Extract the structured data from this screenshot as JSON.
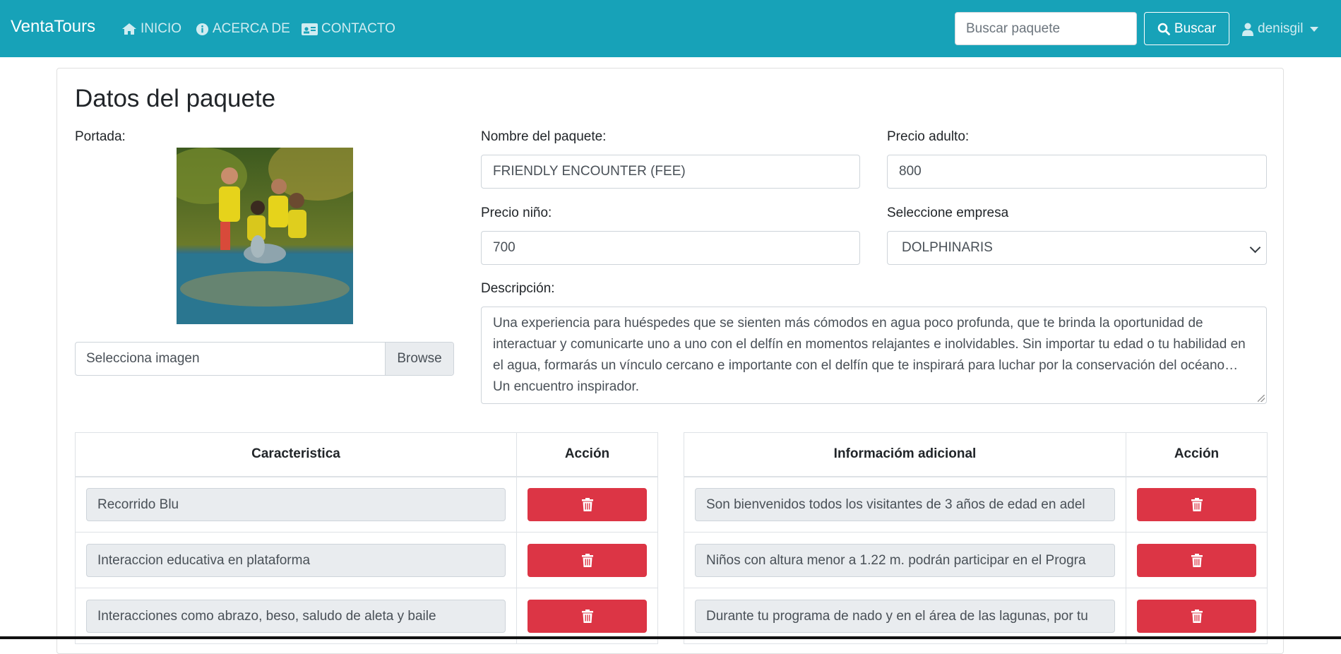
{
  "navbar": {
    "brand": "VentaTours",
    "links": [
      {
        "label": "INICIO",
        "icon": "home-icon"
      },
      {
        "label": "ACERCA DE",
        "icon": "info-circle-icon"
      },
      {
        "label": "CONTACTO",
        "icon": "id-card-icon"
      }
    ],
    "search_placeholder": "Buscar paquete",
    "search_button": "Buscar",
    "user": "denisgil",
    "color": "#17a2b8"
  },
  "form": {
    "title": "Datos del paquete",
    "cover_label": "Portada:",
    "file_placeholder": "Selecciona imagen",
    "file_browse": "Browse",
    "name_label": "Nombre del paquete:",
    "name_value": "FRIENDLY ENCOUNTER (FEE)",
    "adult_price_label": "Precio adulto:",
    "adult_price_value": "800",
    "child_price_label": "Precio niño:",
    "child_price_value": "700",
    "company_label": "Seleccione empresa",
    "company_value": "DOLPHINARIS",
    "description_label": "Descripción:",
    "description_value": "Una experiencia para huéspedes que se sienten más cómodos en agua poco profunda, que te brinda la oportunidad de interactuar y comunicarte uno a uno con el delfín en momentos relajantes e inolvidables. Sin importar tu edad o tu habilidad en el agua, formarás un vínculo cercano e importante con el delfín que te inspirará para luchar por la conservación del océano… Un encuentro inspirador."
  },
  "features_table": {
    "headers": [
      "Caracteristica",
      "Acción"
    ],
    "rows": [
      "Recorrido Blu",
      "Interaccion educativa en plataforma",
      "Interacciones como abrazo, beso, saludo de aleta y baile"
    ]
  },
  "info_table": {
    "headers": [
      "Informacióm adicional",
      "Acción"
    ],
    "rows": [
      "Son bienvenidos todos los visitantes de 3 años de edad en adel",
      "Niños con altura menor a 1.22 m. podrán participar en el Progra",
      "Durante tu programa de nado y en el área de las lagunas, por tu"
    ]
  },
  "colors": {
    "danger": "#dc3545",
    "readonly_bg": "#e9ecef"
  }
}
